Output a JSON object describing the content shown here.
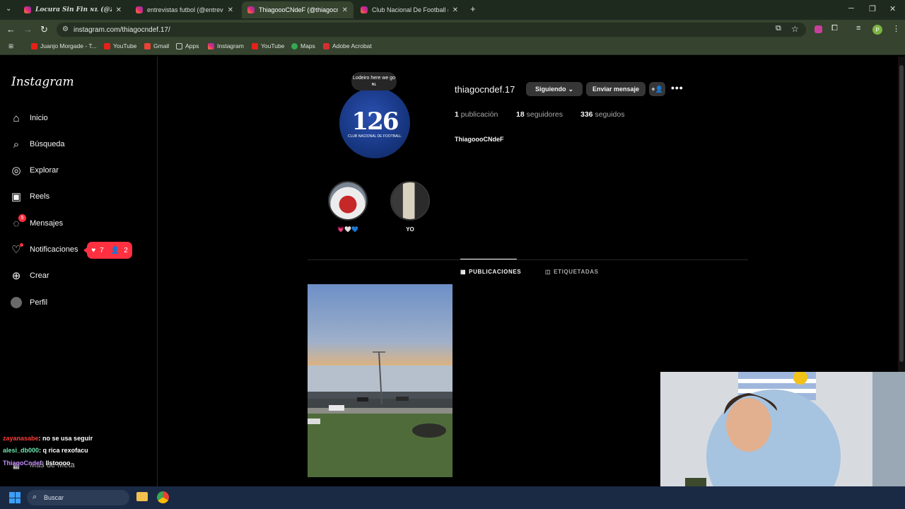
{
  "browser": {
    "tabs": [
      {
        "title": "Locura Sin Fin ɴʟ (@zayan",
        "active": false
      },
      {
        "title": "entrevistas futbol (@entrevistas",
        "active": false
      },
      {
        "title": "ThiagoooCNdeF (@thiagocnde",
        "active": true
      },
      {
        "title": "Club Nacional De Football (@n",
        "active": false
      }
    ],
    "url": "instagram.com/thiagocndef.17/",
    "bookmarks": [
      "Juanjo Morgade - T...",
      "YouTube",
      "Gmail",
      "Apps",
      "Instagram",
      "YouTube",
      "Maps",
      "Adobe Acrobat"
    ]
  },
  "sidebar": {
    "logo": "Instagram",
    "items": [
      {
        "label": "Inicio",
        "icon": "home-icon"
      },
      {
        "label": "Búsqueda",
        "icon": "search-icon"
      },
      {
        "label": "Explorar",
        "icon": "compass-icon"
      },
      {
        "label": "Reels",
        "icon": "reels-icon"
      },
      {
        "label": "Mensajes",
        "icon": "messenger-icon"
      },
      {
        "label": "Notificaciones",
        "icon": "heart-icon"
      },
      {
        "label": "Crear",
        "icon": "plus-square-icon"
      },
      {
        "label": "Perfil",
        "icon": "avatar-icon"
      }
    ],
    "messages_badge": "5",
    "notif_likes": "7",
    "notif_follows": "2",
    "footer_text": "Más de Meta"
  },
  "chat": [
    {
      "user": "zayanasabe",
      "text": ": no se usa seguir",
      "color": "#ff3b3b"
    },
    {
      "user": "alesi_db000",
      "text": ": q rica rexofacu",
      "color": "#6ee6b0"
    },
    {
      "user": "ThiagoCndef",
      "text": ": llstoooo",
      "color": "#c58cff"
    }
  ],
  "profile": {
    "username": "thiagocndef.17",
    "following_button": "Siguiendo",
    "message_button": "Enviar mensaje",
    "note": "Lodeiro here we go ɴʟ",
    "avatar_number": "126",
    "avatar_sub": "CLUB NACIONAL DE FOOTBALL",
    "posts_count": "1",
    "posts_label": "publicación",
    "followers_count": "18",
    "followers_label": "seguidores",
    "following_count": "336",
    "following_label": "seguidos",
    "display_name": "ThiagoooCNdeF",
    "highlights": [
      {
        "label": "💗🤍💙"
      },
      {
        "label": "YO"
      }
    ],
    "tabs": [
      {
        "label": "PUBLICACIONES",
        "active": true
      },
      {
        "label": "ETIQUETADAS",
        "active": false
      }
    ]
  },
  "taskbar": {
    "search_placeholder": "Buscar"
  }
}
